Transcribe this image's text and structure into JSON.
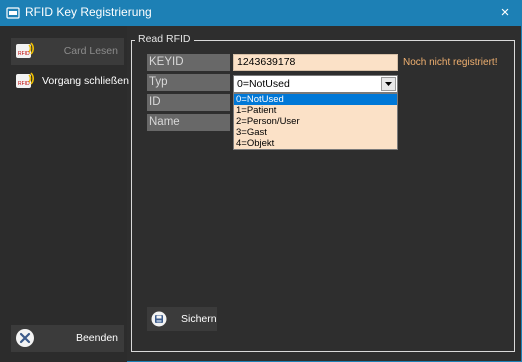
{
  "window": {
    "title": "RFID Key Registrierung",
    "accent_color": "#1d80b5",
    "close_icon": "×"
  },
  "sidebar": {
    "card_lesen": "Card Lesen",
    "vorgang": "Vorgang schließen",
    "beenden": "Beenden",
    "icons": {
      "card_lesen": "rfid-icon",
      "vorgang": "rfid-icon",
      "beenden": "close-circle-icon"
    }
  },
  "group": {
    "legend": "Read RFID"
  },
  "fields": {
    "keyid_label": "KEYID",
    "typ_label": "Typ",
    "id_label": "ID",
    "name_label": "Name",
    "keyid_value": "1243639178",
    "status": "Noch nicht registriert!",
    "typ_selected": "0=NotUsed"
  },
  "typ_options": [
    "0=NotUsed",
    "1=Patient",
    "2=Person/User",
    "3=Gast",
    "4=Objekt"
  ],
  "actions": {
    "save": "Sichern"
  }
}
